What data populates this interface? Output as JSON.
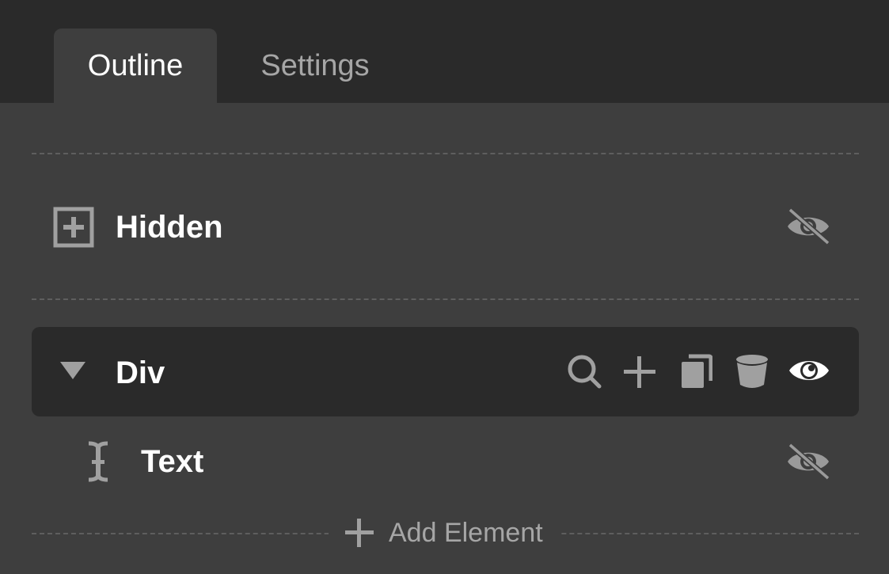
{
  "tabs": [
    {
      "label": "Outline",
      "active": true
    },
    {
      "label": "Settings",
      "active": false
    }
  ],
  "outline": {
    "items": [
      {
        "label": "Hidden",
        "icon": "expand-box-icon",
        "visibility": "hidden"
      },
      {
        "label": "Div",
        "icon": "collapse-triangle-icon",
        "visibility": "visible",
        "selected": true,
        "actions": [
          "search-icon",
          "plus-icon",
          "copy-icon",
          "trash-icon",
          "eye-icon"
        ]
      },
      {
        "label": "Text",
        "icon": "text-cursor-icon",
        "visibility": "hidden"
      }
    ],
    "add_element_label": "Add Element"
  },
  "colors": {
    "background_dark": "#2a2a2a",
    "panel": "#3e3e3e",
    "text_primary": "#ffffff",
    "text_muted": "#a6a6a6",
    "icon_muted": "#9a9a9a"
  }
}
